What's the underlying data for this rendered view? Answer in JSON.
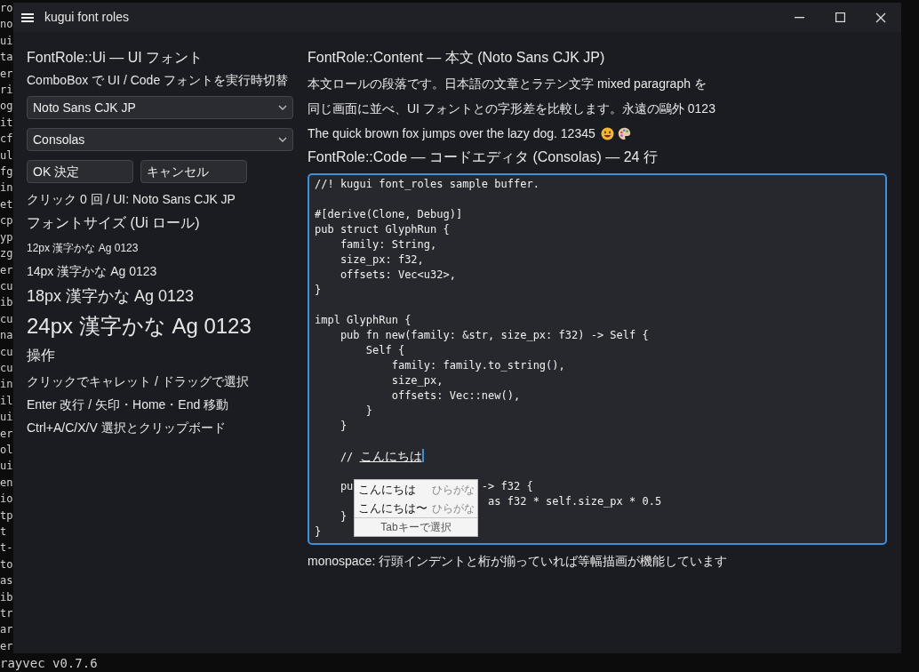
{
  "terminal": {
    "fragments": [
      "ro",
      "no",
      "ui",
      "ta",
      "er",
      "ri",
      "og",
      "it",
      "cf",
      "ul",
      "fg",
      "in",
      "et",
      "cp",
      "yp",
      "zg",
      "er",
      "cu",
      "ib",
      "cu",
      "na",
      "cu",
      "cu",
      "in",
      "il",
      "ui",
      "er",
      "ol",
      "ui",
      "en",
      "io",
      "tp",
      "t ",
      "t-",
      "to",
      "as",
      "ib",
      "tr",
      "ar",
      "er"
    ],
    "last_line": "rayvec v0.7.6"
  },
  "window": {
    "title": "kugui font roles"
  },
  "ui_panel": {
    "heading": "FontRole::Ui — UI フォント",
    "description": "ComboBox で UI / Code フォントを実行時切替",
    "selects": [
      {
        "value": "Noto Sans CJK JP"
      },
      {
        "value": "Consolas"
      }
    ],
    "buttons": [
      {
        "label": "OK 決定"
      },
      {
        "label": "キャンセル"
      }
    ],
    "status": "クリック 0 回 / UI: Noto Sans CJK JP",
    "size_heading": "フォントサイズ (Ui ロール)",
    "samples": [
      {
        "kind": "xs",
        "text": "12px 漢字かな Ag 0123"
      },
      {
        "kind": "sm",
        "text": "14px 漢字かな Ag 0123"
      },
      {
        "kind": "md",
        "text": "18px 漢字かな Ag 0123"
      },
      {
        "kind": "lg",
        "text": "24px 漢字かな Ag 0123"
      }
    ],
    "ops_heading": "操作",
    "ops": [
      "クリックでキャレット / ドラッグで選択",
      "Enter 改行 / 矢印・Home・End 移動",
      "Ctrl+A/C/X/V 選択とクリップボード"
    ]
  },
  "content_panel": {
    "heading": "FontRole::Content — 本文 (Noto Sans CJK JP)",
    "paragraph_lines": [
      "本文ロールの段落です。日本語の文章とラテン文字 mixed paragraph を",
      "同じ画面に並べ、UI フォントとの字形差を比較します。永遠の鷗外 0123"
    ],
    "pangram": "The quick brown fox jumps over the lazy dog. 12345",
    "code_heading": "FontRole::Code — コードエディタ (Consolas) — 24 行",
    "code_lines": [
      {
        "kind": "code",
        "text": "//! kugui font_roles sample buffer."
      },
      {
        "kind": "blank"
      },
      {
        "kind": "code",
        "text": "#[derive(Clone, Debug)]"
      },
      {
        "kind": "code",
        "text": "pub struct GlyphRun {"
      },
      {
        "kind": "code",
        "text": "    family: String,"
      },
      {
        "kind": "code",
        "text": "    size_px: f32,"
      },
      {
        "kind": "code",
        "text": "    offsets: Vec<u32>,"
      },
      {
        "kind": "code",
        "text": "}"
      },
      {
        "kind": "blank"
      },
      {
        "kind": "code",
        "text": "impl GlyphRun {"
      },
      {
        "kind": "code",
        "text": "    pub fn new(family: &str, size_px: f32) -> Self {"
      },
      {
        "kind": "code",
        "text": "        Self {"
      },
      {
        "kind": "code",
        "text": "            family: family.to_string(),"
      },
      {
        "kind": "code",
        "text": "            size_px,"
      },
      {
        "kind": "code",
        "text": "            offsets: Vec::new(),"
      },
      {
        "kind": "code",
        "text": "        }"
      },
      {
        "kind": "code",
        "text": "    }"
      },
      {
        "kind": "blank"
      },
      {
        "kind": "composing",
        "text": "    // ",
        "composition": "こんにちは"
      },
      {
        "kind": "blank"
      },
      {
        "kind": "code",
        "text": "    pu",
        "after": "                          -> f32 {"
      },
      {
        "kind": "code",
        "after": "                           as f32 * self.size_px * 0.5"
      },
      {
        "kind": "code",
        "text": "    }"
      },
      {
        "kind": "code",
        "text": "}"
      }
    ],
    "ime_popup": {
      "candidates": [
        {
          "text": "こんにちは",
          "hint": "ひらがな"
        },
        {
          "text": "こんにちは〜",
          "hint": "ひらがな"
        }
      ],
      "footer": "Tabキーで選択"
    },
    "footer": "monospace: 行頭インデントと桁が揃っていれば等幅描画が機能しています"
  }
}
